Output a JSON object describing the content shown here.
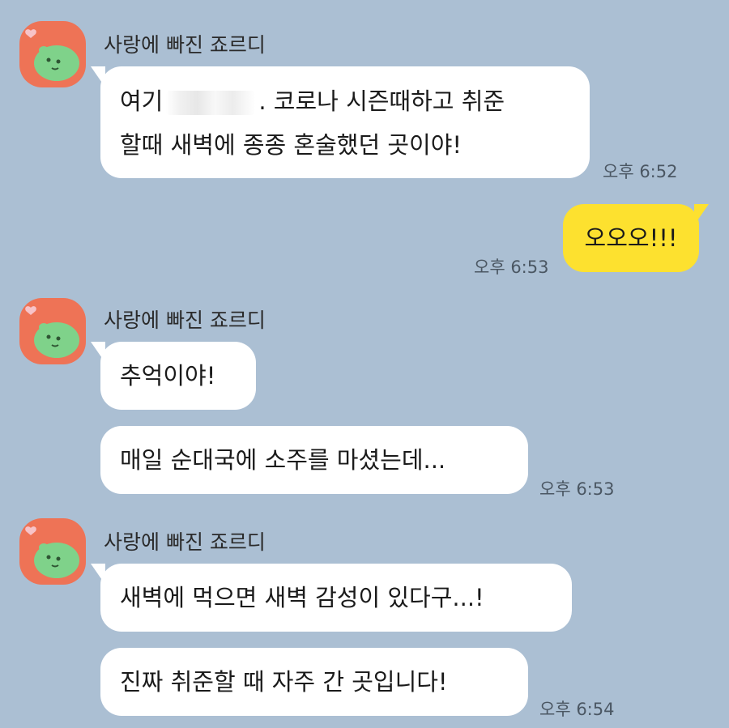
{
  "chat": {
    "sender_name": "사랑에 빠진 죠르디",
    "messages": [
      {
        "line1_a": "여기",
        "line1_b": ". 코로나 시즌때하고 취준",
        "line2": "할때 새벽에 종종 혼술했던 곳이야!",
        "time": "오후 6:52"
      },
      {
        "text": "오오오!!!",
        "time": "오후 6:53"
      },
      {
        "text": "추억이야!"
      },
      {
        "text": "매일 순대국에 소주를 마셨는데...",
        "time": "오후 6:53"
      },
      {
        "text": "새벽에 먹으면 새벽 감성이 있다구...!"
      },
      {
        "text": "진짜 취준할 때 자주 간 곳입니다!",
        "time": "오후 6:54"
      }
    ]
  },
  "colors": {
    "background": "#abbfd3",
    "other_bubble": "#ffffff",
    "my_bubble": "#fde12f",
    "avatar_bg": "#ee7356",
    "avatar_character": "#7fd28a"
  },
  "icons": {
    "avatar": "jordy-character-icon"
  }
}
